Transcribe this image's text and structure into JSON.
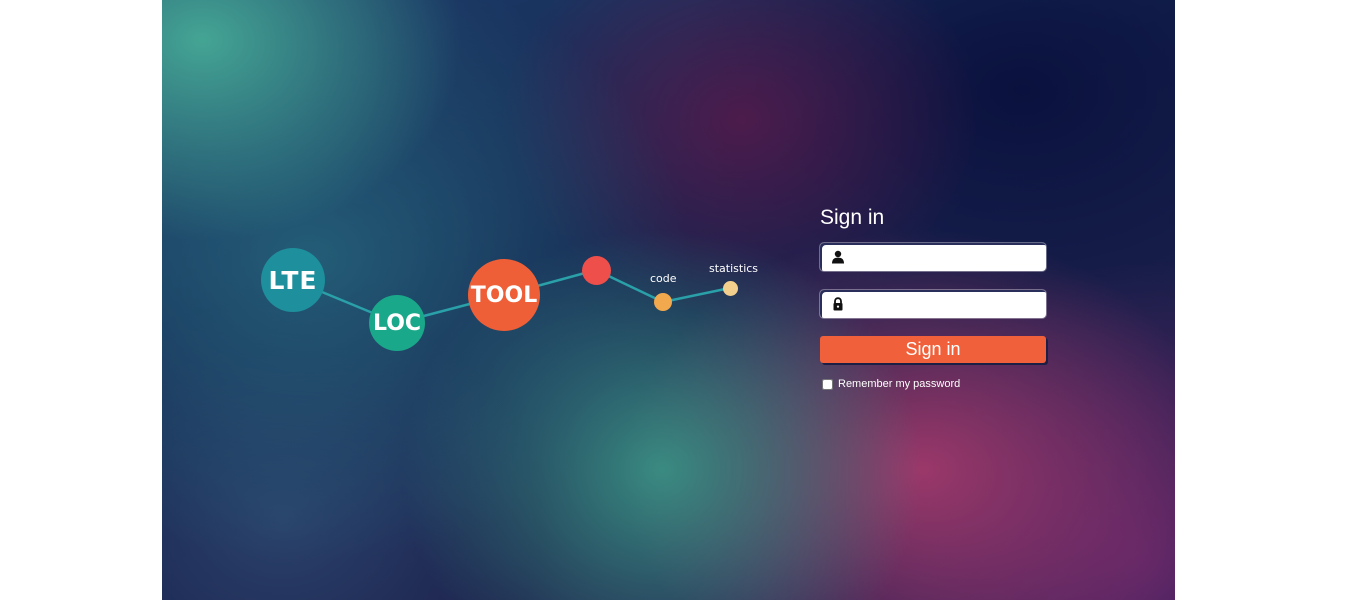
{
  "logo": {
    "nodes": [
      "LTE",
      "LOC",
      "TOOL"
    ],
    "labels": {
      "code": "code",
      "statistics": "statistics"
    },
    "colors": {
      "lte": "#1e8f9c",
      "loc": "#1aa88a",
      "tool": "#ef5f37",
      "dot_red": "#ef4f4a",
      "dot_orange": "#f2a94e",
      "dot_yellow": "#f2cf8c",
      "line": "#2aa0a8"
    }
  },
  "login": {
    "title": "Sign in",
    "username": {
      "value": "",
      "icon": "user-icon"
    },
    "password": {
      "value": "",
      "icon": "lock-icon"
    },
    "submit_label": "Sign in",
    "remember_label": "Remember my password",
    "remember_checked": false,
    "accent": "#f0603a"
  }
}
